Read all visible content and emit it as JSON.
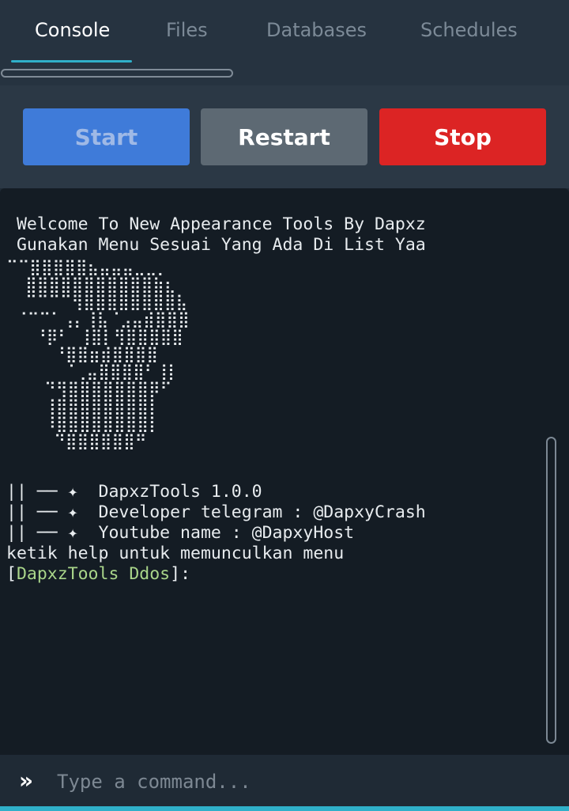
{
  "tabs": [
    {
      "label": "Console",
      "active": true
    },
    {
      "label": "Files",
      "active": false
    },
    {
      "label": "Databases",
      "active": false
    },
    {
      "label": "Schedules",
      "active": false
    }
  ],
  "actions": {
    "start": "Start",
    "restart": "Restart",
    "stop": "Stop"
  },
  "console": {
    "welcome": " Welcome To New Appearance Tools By Dapxz",
    "instruction": " Gunakan Menu Sesuai Yang Ada Di List Yaa",
    "ascii_art": "⠉⠉⣿⣿⣿⣿⣿⣦⣤⣤⣤⣀⣀⡀\n  ⣿⣿⣿⣿⣿⣿⣿⣿⣿⣿⣿⣷⣆\n  ⠉⠉⠉⠉⢻⣿⣿⣿⣿⣿⣿⣿⣿⣧\n ⠈⠉⠉⠁⢠⡄⢸⣧⠈⣠⣤⣾⣿⣿⣿\n   ⠘⡿⠃ ⢸⣿⡇⢻⣿⣿⣿⣿⣿\n     ⠘⣿⣿⣶⣾⣿⣿⣿⣿\n      ⠈⢀⣤⣿⣿⣿⣿⠃⢸⡇\n    ⠙⢻⣿⣿⣿⣿⣿⣿⣿⡿⠋\n    ⢸⣿⣿⣿⣿⣿⣿⣿⣿⡇\n    ⠸⣿⣿⣿⣿⣿⣿⣿⣿⡇\n     ⠙⣿⣿⣿⣿⣿⣿⠛",
    "info1": "|| ── ✦  DapxzTools 1.0.0",
    "info2": "|| ── ✦  Developer telegram : @DapxyCrash",
    "info3": "|| ── ✦  Youtube name : @DapxyHost",
    "help": "ketik help untuk memunculkan menu",
    "prompt_open": "[",
    "prompt_name": "DapxzTools Ddos",
    "prompt_close": "]:"
  },
  "command": {
    "icon": "»",
    "placeholder": "Type a command..."
  },
  "colors": {
    "accent": "#2fb0c9",
    "start": "#3f7bd9",
    "restart": "#5d6973",
    "stop": "#dc2424",
    "prompt_green": "#a9d58a"
  }
}
